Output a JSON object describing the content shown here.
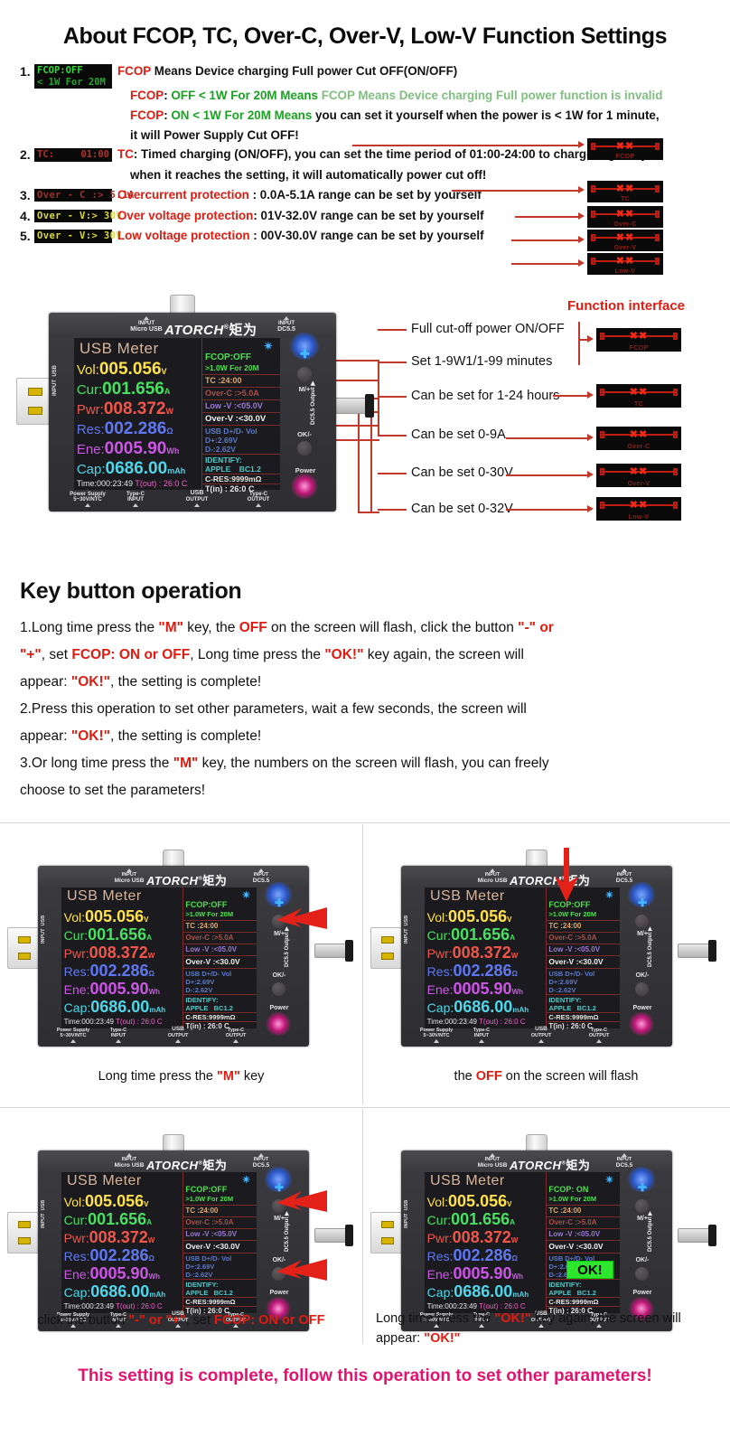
{
  "title": "About FCOP, TC, Over-C, Over-V, Low-V Function Settings",
  "list": [
    {
      "num": "1.",
      "badge_line1": "FCOP:OFF",
      "badge_line2": "< 1W For 20M",
      "lines": [
        {
          "key": "FCOP",
          "sep": " ",
          "rest": "Means Device charging Full power Cut OFF(ON/OFF)"
        },
        {
          "key": "FCOP",
          "sep": ": ",
          "green": "OFF < 1W For 20M Means",
          "rest": " FCOP Means Device charging Full power function is invalid"
        },
        {
          "key": "FCOP",
          "sep": ": ",
          "green": "ON  < 1W For 20M Means",
          "rest": " you can set it yourself when the power is < 1W for 1 minute,"
        },
        {
          "plain": "it will Power Supply Cut OFF!"
        }
      ]
    },
    {
      "num": "2.",
      "badge_left": "TC:",
      "badge_right": "01:00",
      "key": "TC",
      "text1": ": Timed charging (ON/OFF), you can set the time period of 01:00-24:00 to charge regularly",
      "text2": "when it reaches the setting, it will automatically power cut off!"
    },
    {
      "num": "3.",
      "badge": "Over - C :> 5.1A",
      "label": "Overcurrent protection",
      "text": " : 0.0A-5.1A range can be set by yourself"
    },
    {
      "num": "4.",
      "badge": "Over - V:> 30V",
      "label": "Over voltage protection",
      "text": ": 01V-32.0V range can be set by yourself"
    },
    {
      "num": "5.",
      "badge": "Over - V:> 30V",
      "label": "Low voltage protection",
      "text": " : 00V-30.0V range can be set by yourself"
    }
  ],
  "chips_list": [
    "FCOP",
    "TC",
    "Over-C",
    "Over-V",
    "Low-V"
  ],
  "function_interface": {
    "title": "Function interface",
    "callouts": [
      "Full cut-off power ON/OFF",
      "Set 1-9W1/1-99 minutes",
      "Can be set for 1-24 hours",
      "Can be set 0-9A",
      "Can be set 0-30V",
      "Can be set 0-32V"
    ],
    "chips": [
      "FCOP",
      "TC",
      "Over-C",
      "Over-V",
      "Low-V"
    ]
  },
  "device": {
    "brand": "ATORCH",
    "brand_cn": "矩为",
    "top_left_label_1": "INPUT",
    "top_left_label_2": "Micro USB",
    "top_right_label_1": "INPUT",
    "top_right_label_2": "DC5.5",
    "screen_title": "USB Meter",
    "metrics": [
      {
        "label": "Vol:",
        "value": "005.056",
        "unit": "V",
        "cls": "vol"
      },
      {
        "label": "Cur:",
        "value": "001.656",
        "unit": "A",
        "cls": "cur"
      },
      {
        "label": "Pwr:",
        "value": "008.372",
        "unit": "W",
        "cls": "pwr"
      },
      {
        "label": "Res:",
        "value": "002.286",
        "unit": "Ω",
        "cls": "res"
      },
      {
        "label": "Ene:",
        "value": "0005.90",
        "unit": "Wh",
        "cls": "ene"
      },
      {
        "label": "Cap:",
        "value": "0686.00",
        "unit": "mAh",
        "cls": "cap"
      }
    ],
    "time_label": "Time:000:23:49",
    "tout": "T(out) : 26:0 C",
    "right_panel": {
      "fcop": "FCOP:OFF",
      "fcop_on": "FCOP: ON",
      "fcop_sub": ">1.0W  For  20M",
      "tc": "TC  :24:00",
      "overc": "Over-C :>5.0A",
      "lowv": "Low -V :<05.0V",
      "overv": "Over-V :<30.0V",
      "usbdd": "USB D+/D- Vol",
      "dplus": "D+:2.69V",
      "dminus": "D-:2.62V",
      "identify": "IDENTIFY:",
      "apple": "APPLE",
      "bc12": "BC1.2",
      "cres": "C-RES:9999mΩ",
      "tin": "T(in) : 26:0 C",
      "ok": "OK!"
    },
    "side_labels": {
      "input_usb": "INPUT\nUSB",
      "mplus": "M/+",
      "okminus": "OK/-",
      "power": "Power",
      "dc55": "DC5.5\nOutput"
    },
    "bottom_labels": [
      {
        "l1": "Power Supply",
        "l2": "5~30V/NTC"
      },
      {
        "l1": "Type-C",
        "l2": "INPUT"
      },
      {
        "l1": "USB",
        "l2": "OUTPUT"
      },
      {
        "l1": "Type-C",
        "l2": "OUTPUT"
      }
    ]
  },
  "key_button": {
    "heading": "Key button operation",
    "paragraphs": [
      {
        "parts": [
          {
            "t": "1.Long time press the "
          },
          {
            "t": "\"M\"",
            "b": true
          },
          {
            "t": " key, the "
          },
          {
            "t": "OFF",
            "b": true
          },
          {
            "t": " on the screen will flash, click the button "
          },
          {
            "t": "\"-\" or",
            "b": true
          }
        ]
      },
      {
        "parts": [
          {
            "t": "\"+\"",
            "b": true
          },
          {
            "t": ", set "
          },
          {
            "t": "FCOP: ON or OFF",
            "b": true
          },
          {
            "t": ", Long time press the "
          },
          {
            "t": "\"OK!\"",
            "b": true
          },
          {
            "t": " key again, the screen will"
          }
        ]
      },
      {
        "parts": [
          {
            "t": "appear: "
          },
          {
            "t": "\"OK!\"",
            "b": true
          },
          {
            "t": ", the setting is complete!"
          }
        ]
      },
      {
        "parts": [
          {
            "t": "2.Press this operation to set other parameters, wait a few seconds, the screen will"
          }
        ]
      },
      {
        "parts": [
          {
            "t": "appear: "
          },
          {
            "t": "\"OK!\"",
            "b": true
          },
          {
            "t": ", the setting is complete!"
          }
        ]
      },
      {
        "parts": [
          {
            "t": "3.Or long time press the "
          },
          {
            "t": "\"M\"",
            "b": true
          },
          {
            "t": " key, the numbers on the screen will flash, you can freely"
          }
        ]
      },
      {
        "parts": [
          {
            "t": "choose to set the parameters!"
          }
        ]
      }
    ]
  },
  "panels": [
    {
      "id": "panel-1",
      "caption_parts": [
        {
          "t": "Long time press the "
        },
        {
          "t": "\"M\"",
          "b": true
        },
        {
          "t": " key"
        }
      ],
      "fcop": "FCOP:OFF",
      "arrows": [
        "m-plus"
      ]
    },
    {
      "id": "panel-2",
      "caption_parts": [
        {
          "t": "the "
        },
        {
          "t": "OFF",
          "b": true
        },
        {
          "t": " on the screen will flash"
        }
      ],
      "fcop": "FCOP:OFF",
      "arrows": [
        "fcop-down"
      ]
    },
    {
      "id": "panel-3",
      "caption_parts": [
        {
          "t": "click the button "
        },
        {
          "t": "\"-\" or \"+\"",
          "b": true
        },
        {
          "t": ", set "
        },
        {
          "t": "FCOP: ON or OFF",
          "b": true
        }
      ],
      "fcop": "FCOP:OFF",
      "arrows": [
        "m-plus",
        "ok-minus"
      ]
    },
    {
      "id": "panel-4",
      "caption_line1_parts": [
        {
          "t": "Long time press the "
        },
        {
          "t": "\"OK!\"",
          "b": true
        },
        {
          "t": " key again, the screen will"
        }
      ],
      "caption_line2_parts": [
        {
          "t": "appear: "
        },
        {
          "t": "\"OK!\"",
          "b": true
        }
      ],
      "fcop": "FCOP: ON",
      "ok_badge": "OK!",
      "arrows": []
    }
  ],
  "final_note": "This setting is complete, follow this operation to set other parameters!"
}
